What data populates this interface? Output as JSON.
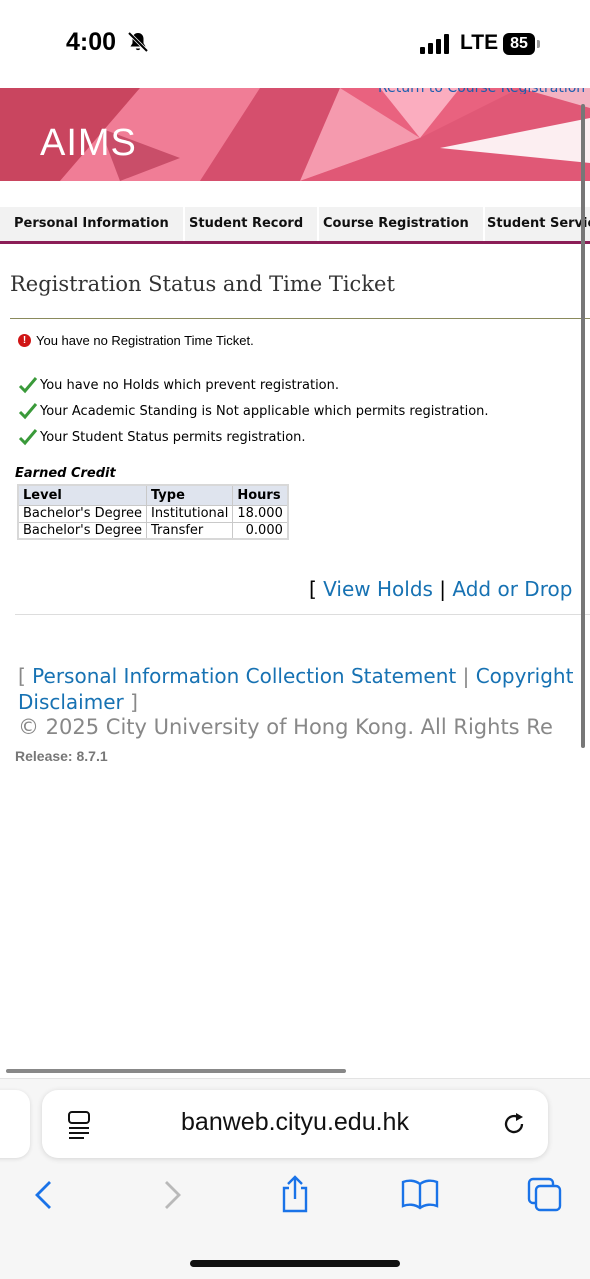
{
  "status_bar": {
    "time": "4:00",
    "network": "LTE",
    "battery": "85",
    "icons": [
      "bell-slash-icon",
      "signal-icon"
    ]
  },
  "banner": {
    "logo": "AIMS",
    "return_link": "Return to Course Registration"
  },
  "nav": {
    "tabs": [
      {
        "label": "Personal Information"
      },
      {
        "label": "Student Record"
      },
      {
        "label": "Course Registration"
      },
      {
        "label": "Student Service"
      }
    ],
    "accent_color": "#8b1e57"
  },
  "main": {
    "title": "Registration Status and Time Ticket",
    "error_message": "You have no Registration Time Ticket.",
    "ok_messages": [
      "You have no Holds which prevent registration.",
      "Your Academic Standing is Not applicable which permits registration.",
      "Your Student Status permits registration."
    ],
    "earned_credit": {
      "caption": "Earned Credit",
      "columns": [
        "Level",
        "Type",
        "Hours"
      ],
      "rows": [
        [
          "Bachelor's Degree",
          "Institutional",
          "18.000"
        ],
        [
          "Bachelor's Degree",
          "Transfer",
          "0.000"
        ]
      ]
    },
    "links": {
      "open": "[",
      "view_holds": "View Holds",
      "divider": "|",
      "add_drop": "Add or Drop"
    }
  },
  "footer": {
    "open": "[",
    "pics": "Personal Information Collection Statement",
    "divider": "|",
    "copyright_link": "Copyright",
    "disclaimer": "Disclaimer",
    "close": "]",
    "copyright": "© 2025 City University of Hong Kong. All Rights Re",
    "release": "Release: 8.7.1"
  },
  "browser": {
    "url": "banweb.cityu.edu.hk",
    "icons": [
      "tab-format-icon",
      "reload-icon",
      "back-icon",
      "forward-icon",
      "share-icon",
      "bookmarks-icon",
      "tabs-icon"
    ]
  }
}
